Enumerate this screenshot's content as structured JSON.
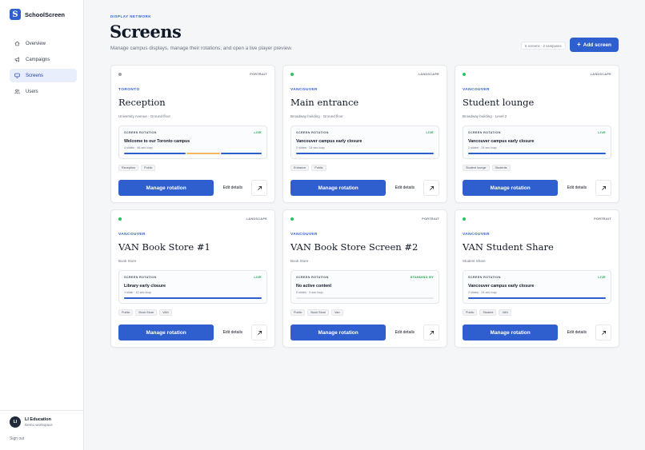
{
  "brand": {
    "logo_letter": "S",
    "name": "SchoolScreen",
    "color": "#2f5fce"
  },
  "nav": [
    {
      "label": "Overview",
      "icon": "home-icon",
      "active": false
    },
    {
      "label": "Campaigns",
      "icon": "megaphone-icon",
      "active": false
    },
    {
      "label": "Screens",
      "icon": "monitor-icon",
      "active": true
    },
    {
      "label": "Users",
      "icon": "users-icon",
      "active": false
    }
  ],
  "account": {
    "initials": "LI",
    "name": "LI Education",
    "subtitle": "Demo workspace",
    "signout": "Sign out"
  },
  "header": {
    "eyebrow": "DISPLAY NETWORK",
    "title": "Screens",
    "subtitle": "Manage campus displays, manage their rotations, and open a live player preview.",
    "counts": "6 screens · 2 campuses",
    "add_label": "Add screen"
  },
  "rotation_label": "SCREEN ROTATION",
  "actions": {
    "manage": "Manage rotation",
    "edit": "Edit details"
  },
  "colors": {
    "online": "#22c55e",
    "offline": "#9ca3af",
    "live": "#16a34a",
    "standby": "#16a34a",
    "primary": "#2f5fce",
    "segment_alt": "#f4b860"
  },
  "screens": [
    {
      "status": "offline",
      "orientation": "PORTRAIT",
      "campus": "TORONTO",
      "name": "Reception",
      "location": "University Avenue · Ground floor",
      "rotation": {
        "state": "LIVE",
        "title": "Welcome to our Toronto campus",
        "meta": "4 slides · 46 sec loop",
        "segments": [
          {
            "share": 0.45,
            "color": "#2f5fce"
          },
          {
            "share": 0.25,
            "color": "#f4b860"
          },
          {
            "share": 0.3,
            "color": "#2f5fce"
          }
        ]
      },
      "tags": [
        "Reception",
        "Public"
      ]
    },
    {
      "status": "online",
      "orientation": "LANDSCAPE",
      "campus": "VANCOUVER",
      "name": "Main entrance",
      "location": "Broadway building · Ground floor",
      "rotation": {
        "state": "LIVE",
        "title": "Vancouver campus early closure",
        "meta": "2 slides · 24 sec loop",
        "segments": [
          {
            "share": 1,
            "color": "#2f5fce"
          }
        ]
      },
      "tags": [
        "Entrance",
        "Public"
      ]
    },
    {
      "status": "online",
      "orientation": "LANDSCAPE",
      "campus": "VANCOUVER",
      "name": "Student lounge",
      "location": "Broadway building · Level 2",
      "rotation": {
        "state": "LIVE",
        "title": "Vancouver campus early closure",
        "meta": "2 slides · 24 sec loop",
        "segments": [
          {
            "share": 1,
            "color": "#2f5fce"
          }
        ]
      },
      "tags": [
        "Student lounge",
        "Students"
      ]
    },
    {
      "status": "online",
      "orientation": "LANDSCAPE",
      "campus": "VANCOUVER",
      "name": "VAN Book Store #1",
      "location": "Book Store",
      "rotation": {
        "state": "LIVE",
        "title": "Library early closure",
        "meta": "1 slide · 12 sec loop",
        "segments": [
          {
            "share": 1,
            "color": "#2f5fce"
          }
        ]
      },
      "tags": [
        "Public",
        "Book Store",
        "VAN"
      ]
    },
    {
      "status": "online",
      "orientation": "PORTRAIT",
      "campus": "VANCOUVER",
      "name": "VAN Book Store Screen #2",
      "location": "Book Store",
      "rotation": {
        "state": "STANDING BY",
        "title": "No active content",
        "meta": "0 slides · 0 sec loop",
        "segments": [
          {
            "share": 1,
            "color": "#e5e7eb"
          }
        ]
      },
      "tags": [
        "Public",
        "Book Store",
        "Van"
      ]
    },
    {
      "status": "online",
      "orientation": "PORTRAIT",
      "campus": "VANCOUVER",
      "name": "VAN Student Share",
      "location": "Student Share",
      "rotation": {
        "state": "LIVE",
        "title": "Vancouver campus early closure",
        "meta": "2 slides · 24 sec loop",
        "segments": [
          {
            "share": 1,
            "color": "#2f5fce"
          }
        ]
      },
      "tags": [
        "Public",
        "Student",
        "VAN"
      ]
    }
  ]
}
